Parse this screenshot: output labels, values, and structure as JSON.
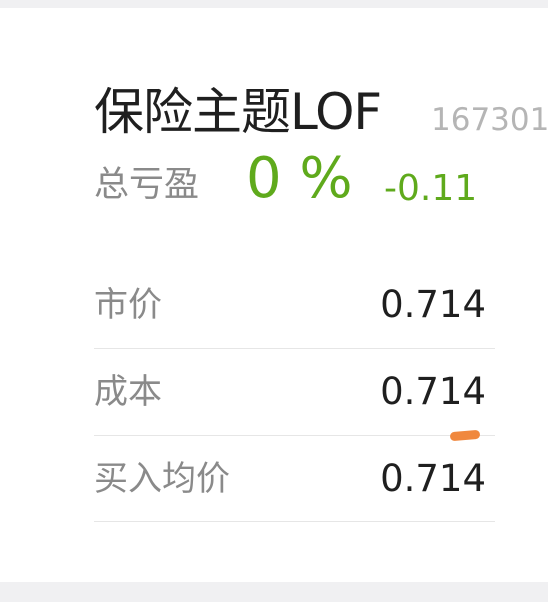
{
  "fund": {
    "name": "保险主题LOF",
    "code": "167301"
  },
  "summary": {
    "profit_loss_label": "总亏盈",
    "profit_loss_percent": "0 %",
    "profit_loss_amount": "-0.11"
  },
  "details": [
    {
      "label": "市价",
      "value": "0.714"
    },
    {
      "label": "成本",
      "value": "0.714"
    },
    {
      "label": "买入均价",
      "value": "0.714"
    }
  ],
  "colors": {
    "gain_loss": "#5faa1c",
    "annotation_mark": "#f0883e"
  }
}
